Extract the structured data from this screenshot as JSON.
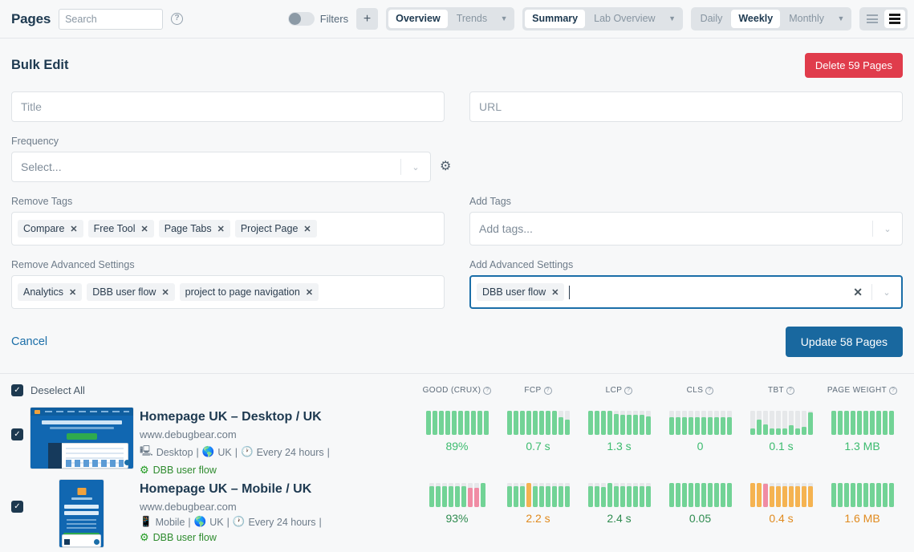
{
  "topbar": {
    "title": "Pages",
    "search_placeholder": "Search",
    "help_icon": "question-circle-icon",
    "filters_label": "Filters",
    "add_label": "+",
    "view_segments": [
      {
        "label": "Overview",
        "active": true
      },
      {
        "label": "Trends",
        "active": false
      }
    ],
    "summary_segments": [
      {
        "label": "Summary",
        "active": true
      },
      {
        "label": "Lab Overview",
        "active": false
      }
    ],
    "period_segments": [
      {
        "label": "Daily",
        "active": false
      },
      {
        "label": "Weekly",
        "active": true
      },
      {
        "label": "Monthly",
        "active": false
      }
    ]
  },
  "bulk_edit": {
    "title": "Bulk Edit",
    "delete_label": "Delete 59 Pages",
    "title_placeholder": "Title",
    "url_placeholder": "URL",
    "frequency_label": "Frequency",
    "frequency_value": "Select...",
    "gear_icon": "gear-icon",
    "remove_tags_label": "Remove Tags",
    "remove_tags": [
      "Compare",
      "Free Tool",
      "Page Tabs",
      "Project Page"
    ],
    "add_tags_label": "Add Tags",
    "add_tags_placeholder": "Add tags...",
    "remove_adv_label": "Remove Advanced Settings",
    "remove_adv": [
      "Analytics",
      "DBB user flow",
      "project to page navigation"
    ],
    "add_adv_label": "Add Advanced Settings",
    "add_adv": [
      "DBB user flow"
    ],
    "cancel_label": "Cancel",
    "update_label": "Update 58 Pages",
    "focus_color": "#1b6ea8",
    "danger_color": "#e03c4c",
    "primary_color": "#19689f"
  },
  "list": {
    "deselect_label": "Deselect All",
    "columns": [
      {
        "label": "GOOD (CRUX)"
      },
      {
        "label": "FCP"
      },
      {
        "label": "LCP"
      },
      {
        "label": "CLS"
      },
      {
        "label": "TBT"
      },
      {
        "label": "PAGE WEIGHT"
      }
    ],
    "rows": [
      {
        "checked": true,
        "thumb": "desktop",
        "title": "Homepage UK – Desktop / UK",
        "url": "www.debugbear.com",
        "device_icon": "desktop-icon",
        "device": "Desktop",
        "region_icon": "globe-icon",
        "region": "UK",
        "clock_icon": "clock-icon",
        "frequency": "Every 24 hours",
        "flow_icon": "gear-icon",
        "flow": "DBB user flow",
        "metrics": [
          {
            "value": "89%",
            "color": "#3bbb6e",
            "bars": [
              100,
              100,
              100,
              100,
              100,
              100,
              100,
              100,
              100,
              100
            ],
            "colors": [
              "g",
              "g",
              "g",
              "g",
              "g",
              "g",
              "g",
              "g",
              "g",
              "g"
            ]
          },
          {
            "value": "0.7 s",
            "color": "#3bbb6e",
            "bars": [
              100,
              100,
              100,
              100,
              100,
              100,
              100,
              100,
              72,
              62
            ],
            "colors": [
              "g",
              "g",
              "g",
              "g",
              "g",
              "g",
              "g",
              "g",
              "g",
              "g"
            ]
          },
          {
            "value": "1.3 s",
            "color": "#3bbb6e",
            "bars": [
              100,
              100,
              100,
              100,
              88,
              84,
              84,
              84,
              84,
              78
            ],
            "colors": [
              "g",
              "g",
              "g",
              "g",
              "g",
              "g",
              "g",
              "g",
              "g",
              "g"
            ]
          },
          {
            "value": "0",
            "color": "#3bbb6e",
            "bars": [
              72,
              72,
              72,
              72,
              72,
              72,
              72,
              72,
              72,
              72
            ],
            "colors": [
              "g",
              "g",
              "g",
              "g",
              "g",
              "g",
              "g",
              "g",
              "g",
              "g"
            ]
          },
          {
            "value": "0.1 s",
            "color": "#3bbb6e",
            "bars": [
              28,
              62,
              42,
              28,
              28,
              28,
              40,
              28,
              32,
              92
            ],
            "colors": [
              "g",
              "g",
              "g",
              "g",
              "g",
              "g",
              "g",
              "g",
              "g",
              "g"
            ]
          },
          {
            "value": "1.3 MB",
            "color": "#3bbb6e",
            "bars": [
              100,
              100,
              100,
              100,
              100,
              100,
              100,
              100,
              100,
              100
            ],
            "colors": [
              "g",
              "g",
              "g",
              "g",
              "g",
              "g",
              "g",
              "g",
              "g",
              "g"
            ]
          }
        ]
      },
      {
        "checked": true,
        "thumb": "mobile",
        "title": "Homepage UK – Mobile / UK",
        "url": "www.debugbear.com",
        "device_icon": "mobile-icon",
        "device": "Mobile",
        "region_icon": "globe-icon",
        "region": "UK",
        "clock_icon": "clock-icon",
        "frequency": "Every 24 hours",
        "flow_icon": "gear-icon",
        "flow": "DBB user flow",
        "metrics": [
          {
            "value": "93%",
            "color": "#2e8b4f",
            "bars": [
              88,
              88,
              88,
              88,
              88,
              88,
              80,
              80,
              100
            ],
            "colors": [
              "g",
              "g",
              "g",
              "g",
              "g",
              "g",
              "p",
              "p",
              "g"
            ]
          },
          {
            "value": "2.2 s",
            "color": "#e08a1e",
            "bars": [
              88,
              88,
              88,
              100,
              88,
              88,
              88,
              88,
              88,
              88
            ],
            "colors": [
              "g",
              "g",
              "g",
              "o",
              "g",
              "g",
              "g",
              "g",
              "g",
              "g"
            ]
          },
          {
            "value": "2.4 s",
            "color": "#2e8b4f",
            "bars": [
              88,
              88,
              84,
              100,
              88,
              88,
              88,
              88,
              88,
              88
            ],
            "colors": [
              "g",
              "g",
              "g",
              "g",
              "g",
              "g",
              "g",
              "g",
              "g",
              "g"
            ]
          },
          {
            "value": "0.05",
            "color": "#2e8b4f",
            "bars": [
              100,
              100,
              100,
              100,
              100,
              100,
              100,
              100,
              100,
              100
            ],
            "colors": [
              "g",
              "g",
              "g",
              "g",
              "g",
              "g",
              "g",
              "g",
              "g",
              "g"
            ]
          },
          {
            "value": "0.4 s",
            "color": "#e08a1e",
            "bars": [
              100,
              100,
              96,
              88,
              88,
              88,
              88,
              88,
              88,
              88
            ],
            "colors": [
              "o",
              "o",
              "p",
              "o",
              "o",
              "o",
              "o",
              "o",
              "o",
              "o"
            ]
          },
          {
            "value": "1.6 MB",
            "color": "#e08a1e",
            "bars": [
              100,
              100,
              100,
              100,
              100,
              100,
              100,
              100,
              100,
              100
            ],
            "colors": [
              "g",
              "g",
              "g",
              "g",
              "g",
              "g",
              "g",
              "g",
              "g",
              "g"
            ]
          }
        ]
      }
    ]
  },
  "bar_palette": {
    "g": "#72d396",
    "o": "#f5b351",
    "p": "#f08ca4",
    "track": "#e6e8ea"
  }
}
